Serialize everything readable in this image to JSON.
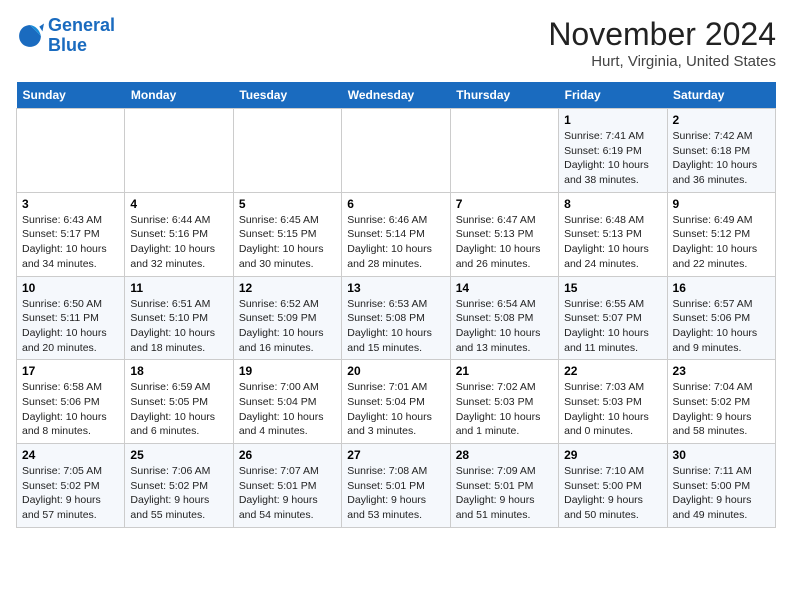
{
  "header": {
    "logo_line1": "General",
    "logo_line2": "Blue",
    "title": "November 2024",
    "subtitle": "Hurt, Virginia, United States"
  },
  "days_of_week": [
    "Sunday",
    "Monday",
    "Tuesday",
    "Wednesday",
    "Thursday",
    "Friday",
    "Saturday"
  ],
  "weeks": [
    [
      {
        "day": "",
        "info": ""
      },
      {
        "day": "",
        "info": ""
      },
      {
        "day": "",
        "info": ""
      },
      {
        "day": "",
        "info": ""
      },
      {
        "day": "",
        "info": ""
      },
      {
        "day": "1",
        "info": "Sunrise: 7:41 AM\nSunset: 6:19 PM\nDaylight: 10 hours\nand 38 minutes."
      },
      {
        "day": "2",
        "info": "Sunrise: 7:42 AM\nSunset: 6:18 PM\nDaylight: 10 hours\nand 36 minutes."
      }
    ],
    [
      {
        "day": "3",
        "info": "Sunrise: 6:43 AM\nSunset: 5:17 PM\nDaylight: 10 hours\nand 34 minutes."
      },
      {
        "day": "4",
        "info": "Sunrise: 6:44 AM\nSunset: 5:16 PM\nDaylight: 10 hours\nand 32 minutes."
      },
      {
        "day": "5",
        "info": "Sunrise: 6:45 AM\nSunset: 5:15 PM\nDaylight: 10 hours\nand 30 minutes."
      },
      {
        "day": "6",
        "info": "Sunrise: 6:46 AM\nSunset: 5:14 PM\nDaylight: 10 hours\nand 28 minutes."
      },
      {
        "day": "7",
        "info": "Sunrise: 6:47 AM\nSunset: 5:13 PM\nDaylight: 10 hours\nand 26 minutes."
      },
      {
        "day": "8",
        "info": "Sunrise: 6:48 AM\nSunset: 5:13 PM\nDaylight: 10 hours\nand 24 minutes."
      },
      {
        "day": "9",
        "info": "Sunrise: 6:49 AM\nSunset: 5:12 PM\nDaylight: 10 hours\nand 22 minutes."
      }
    ],
    [
      {
        "day": "10",
        "info": "Sunrise: 6:50 AM\nSunset: 5:11 PM\nDaylight: 10 hours\nand 20 minutes."
      },
      {
        "day": "11",
        "info": "Sunrise: 6:51 AM\nSunset: 5:10 PM\nDaylight: 10 hours\nand 18 minutes."
      },
      {
        "day": "12",
        "info": "Sunrise: 6:52 AM\nSunset: 5:09 PM\nDaylight: 10 hours\nand 16 minutes."
      },
      {
        "day": "13",
        "info": "Sunrise: 6:53 AM\nSunset: 5:08 PM\nDaylight: 10 hours\nand 15 minutes."
      },
      {
        "day": "14",
        "info": "Sunrise: 6:54 AM\nSunset: 5:08 PM\nDaylight: 10 hours\nand 13 minutes."
      },
      {
        "day": "15",
        "info": "Sunrise: 6:55 AM\nSunset: 5:07 PM\nDaylight: 10 hours\nand 11 minutes."
      },
      {
        "day": "16",
        "info": "Sunrise: 6:57 AM\nSunset: 5:06 PM\nDaylight: 10 hours\nand 9 minutes."
      }
    ],
    [
      {
        "day": "17",
        "info": "Sunrise: 6:58 AM\nSunset: 5:06 PM\nDaylight: 10 hours\nand 8 minutes."
      },
      {
        "day": "18",
        "info": "Sunrise: 6:59 AM\nSunset: 5:05 PM\nDaylight: 10 hours\nand 6 minutes."
      },
      {
        "day": "19",
        "info": "Sunrise: 7:00 AM\nSunset: 5:04 PM\nDaylight: 10 hours\nand 4 minutes."
      },
      {
        "day": "20",
        "info": "Sunrise: 7:01 AM\nSunset: 5:04 PM\nDaylight: 10 hours\nand 3 minutes."
      },
      {
        "day": "21",
        "info": "Sunrise: 7:02 AM\nSunset: 5:03 PM\nDaylight: 10 hours\nand 1 minute."
      },
      {
        "day": "22",
        "info": "Sunrise: 7:03 AM\nSunset: 5:03 PM\nDaylight: 10 hours\nand 0 minutes."
      },
      {
        "day": "23",
        "info": "Sunrise: 7:04 AM\nSunset: 5:02 PM\nDaylight: 9 hours\nand 58 minutes."
      }
    ],
    [
      {
        "day": "24",
        "info": "Sunrise: 7:05 AM\nSunset: 5:02 PM\nDaylight: 9 hours\nand 57 minutes."
      },
      {
        "day": "25",
        "info": "Sunrise: 7:06 AM\nSunset: 5:02 PM\nDaylight: 9 hours\nand 55 minutes."
      },
      {
        "day": "26",
        "info": "Sunrise: 7:07 AM\nSunset: 5:01 PM\nDaylight: 9 hours\nand 54 minutes."
      },
      {
        "day": "27",
        "info": "Sunrise: 7:08 AM\nSunset: 5:01 PM\nDaylight: 9 hours\nand 53 minutes."
      },
      {
        "day": "28",
        "info": "Sunrise: 7:09 AM\nSunset: 5:01 PM\nDaylight: 9 hours\nand 51 minutes."
      },
      {
        "day": "29",
        "info": "Sunrise: 7:10 AM\nSunset: 5:00 PM\nDaylight: 9 hours\nand 50 minutes."
      },
      {
        "day": "30",
        "info": "Sunrise: 7:11 AM\nSunset: 5:00 PM\nDaylight: 9 hours\nand 49 minutes."
      }
    ]
  ]
}
